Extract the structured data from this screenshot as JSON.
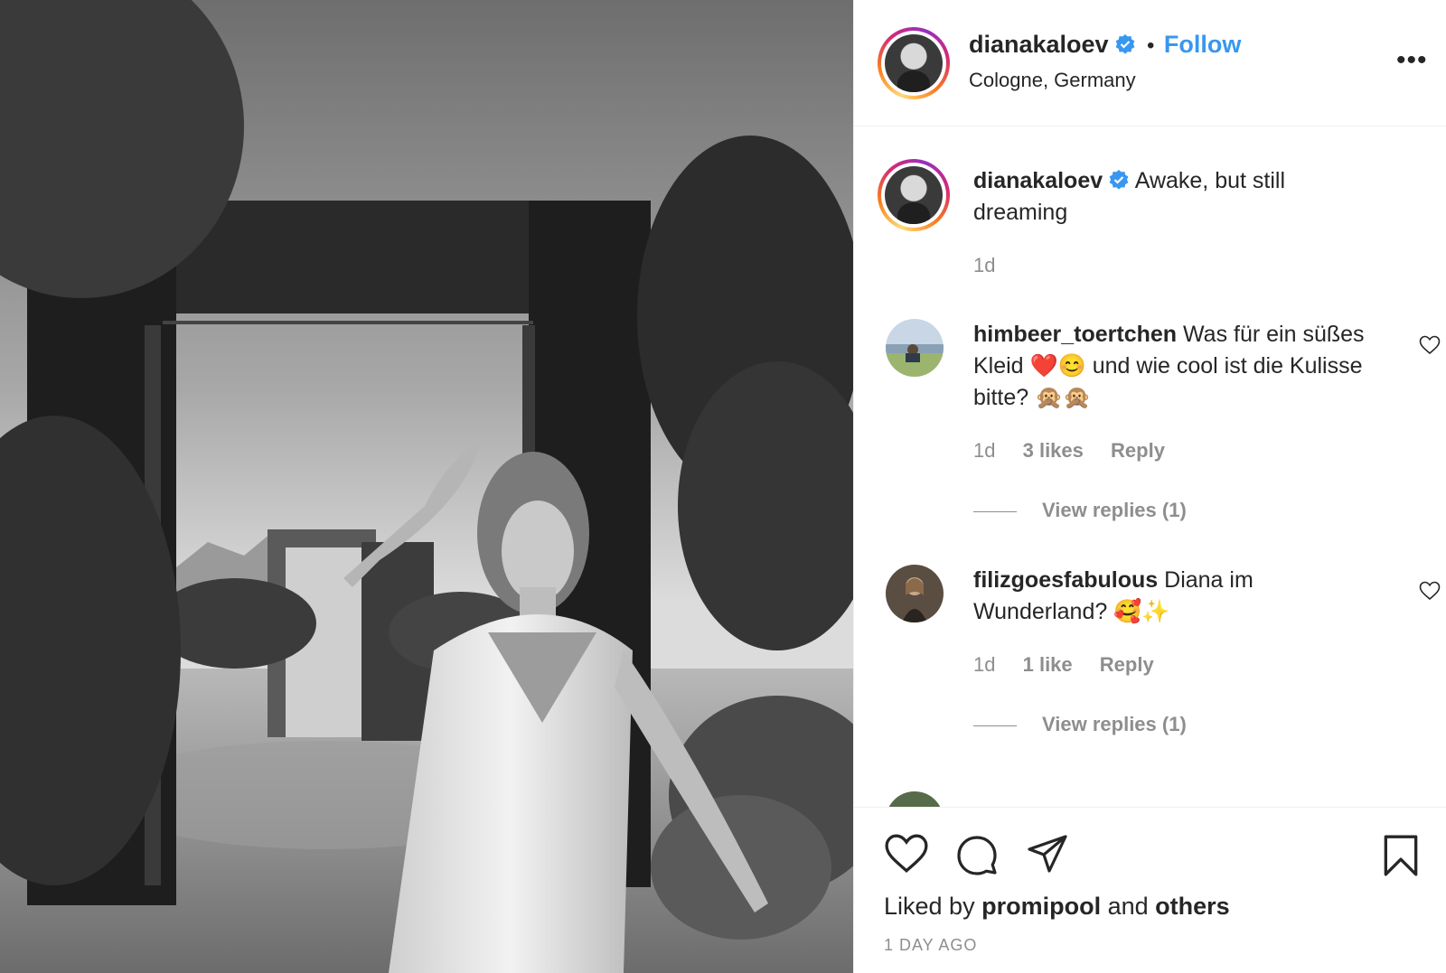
{
  "photo": {
    "alt": ""
  },
  "header": {
    "username": "dianakaloev",
    "separator": "•",
    "follow_label": "Follow",
    "location": "Cologne, Germany",
    "more_label": "•••"
  },
  "caption": {
    "username": "dianakaloev",
    "text": "Awake, but still dreaming",
    "time": "1d"
  },
  "comments": [
    {
      "username": "himbeer_toertchen",
      "text": "Was für ein süßes Kleid ❤️😊 und wie cool ist die Kulisse bitte? 🙊🙊",
      "time": "1d",
      "likes": "3 likes",
      "reply_label": "Reply",
      "view_replies": "View replies (1)"
    },
    {
      "username": "filizgoesfabulous",
      "text": "Diana im Wunderland? 🥰✨",
      "time": "1d",
      "likes": "1 like",
      "reply_label": "Reply",
      "view_replies": "View replies (1)"
    }
  ],
  "footer": {
    "liked_prefix": "Liked by",
    "liked_user": "promipool",
    "liked_and": "and",
    "liked_others": "others",
    "timestamp": "1 DAY AGO"
  },
  "icons": {
    "verified": "verified-badge-icon",
    "like": "heart-icon",
    "comment": "comment-bubble-icon",
    "share": "paper-plane-icon",
    "save": "bookmark-icon"
  },
  "colors": {
    "accent": "#3897f0",
    "text": "#262626",
    "muted": "#8e8e8e",
    "border": "#efefef"
  }
}
